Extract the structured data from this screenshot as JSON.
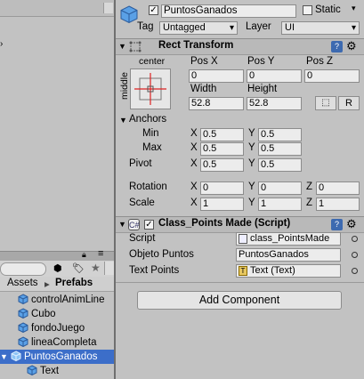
{
  "project": {
    "breadcrumb": [
      "Assets",
      "Prefabs"
    ],
    "items": [
      {
        "label": "controlAnimLine",
        "selected": false
      },
      {
        "label": "Cubo",
        "selected": false
      },
      {
        "label": "fondoJuego",
        "selected": false
      },
      {
        "label": "lineaCompleta",
        "selected": false
      },
      {
        "label": "PuntosGanados",
        "selected": true
      },
      {
        "label": "Text",
        "selected": false
      }
    ]
  },
  "inspector": {
    "object_name": "PuntosGanados",
    "static_label": "Static",
    "tag_label": "Tag",
    "tag_value": "Untagged",
    "layer_label": "Layer",
    "layer_value": "UI",
    "rect_transform": {
      "title": "Rect Transform",
      "anchor_preset_top": "center",
      "anchor_preset_side": "middle",
      "pos_x_label": "Pos X",
      "pos_y_label": "Pos Y",
      "pos_z_label": "Pos Z",
      "pos_x": "0",
      "pos_y": "0",
      "pos_z": "0",
      "width_label": "Width",
      "height_label": "Height",
      "width": "52.8",
      "height": "52.8",
      "raw_button": "R",
      "anchors_label": "Anchors",
      "min_label": "Min",
      "max_label": "Max",
      "min_x": "0.5",
      "min_y": "0.5",
      "max_x": "0.5",
      "max_y": "0.5",
      "pivot_label": "Pivot",
      "pivot_x": "0.5",
      "pivot_y": "0.5",
      "rotation_label": "Rotation",
      "rot_x": "0",
      "rot_y": "0",
      "rot_z": "0",
      "scale_label": "Scale",
      "scale_x": "1",
      "scale_y": "1",
      "scale_z": "1",
      "axis_x": "X",
      "axis_y": "Y",
      "axis_z": "Z"
    },
    "script_component": {
      "title": "Class_Points Made (Script)",
      "script_label": "Script",
      "script_value": "class_PointsMade",
      "objeto_label": "Objeto Puntos",
      "objeto_value": "PuntosGanados",
      "text_points_label": "Text Points",
      "text_points_value": "Text (Text)"
    },
    "add_component": "Add Component"
  },
  "colors": {
    "selection": "#3c6ec9",
    "cube_blue": "#5aa0e6",
    "panel": "#c2c2c2"
  }
}
